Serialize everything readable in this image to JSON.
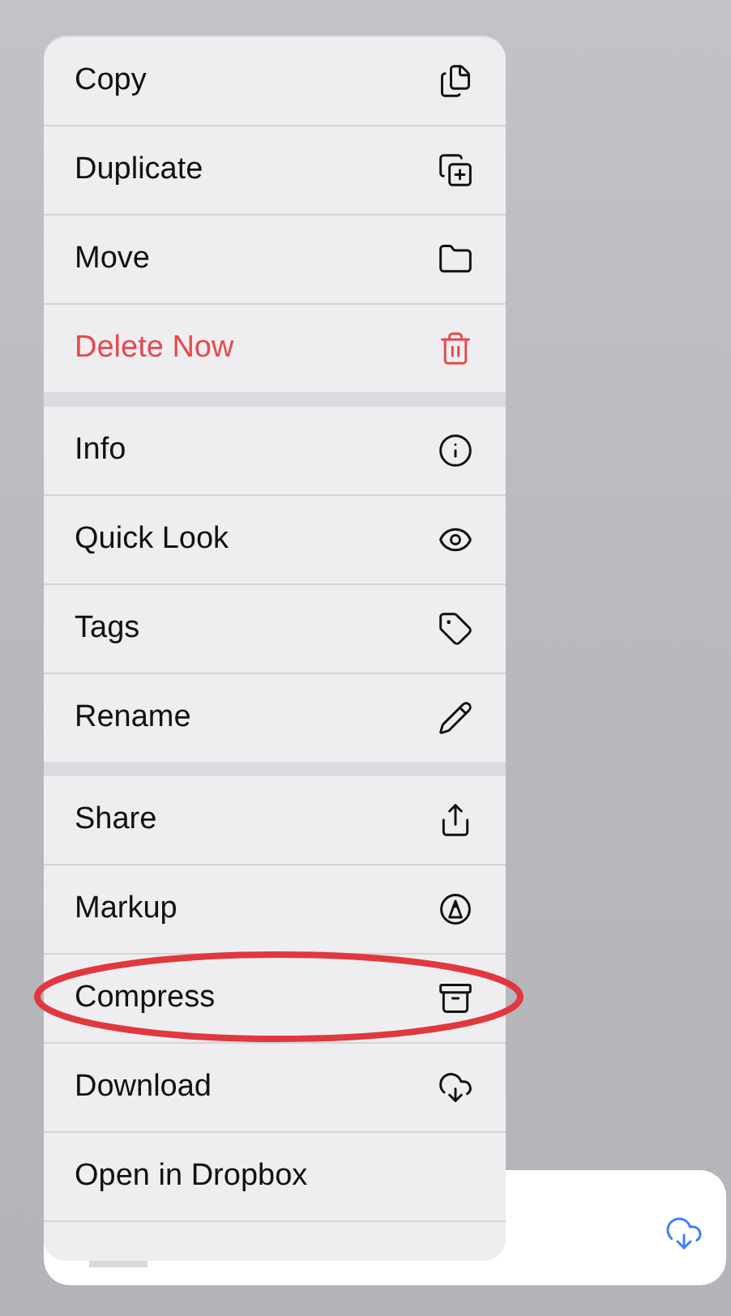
{
  "menu": {
    "groups": [
      {
        "items": [
          {
            "label": "Copy",
            "destructive": false,
            "circled": false
          },
          {
            "label": "Duplicate",
            "destructive": false,
            "circled": false
          },
          {
            "label": "Move",
            "destructive": false,
            "circled": false
          },
          {
            "label": "Delete Now",
            "destructive": true,
            "circled": false
          }
        ]
      },
      {
        "items": [
          {
            "label": "Info",
            "destructive": false,
            "circled": false
          },
          {
            "label": "Quick Look",
            "destructive": false,
            "circled": false
          },
          {
            "label": "Tags",
            "destructive": false,
            "circled": false
          },
          {
            "label": "Rename",
            "destructive": false,
            "circled": false
          }
        ]
      },
      {
        "items": [
          {
            "label": "Share",
            "destructive": false,
            "circled": false
          },
          {
            "label": "Markup",
            "destructive": false,
            "circled": false
          },
          {
            "label": "Compress",
            "destructive": false,
            "circled": true
          },
          {
            "label": "Download",
            "destructive": false,
            "circled": false
          },
          {
            "label": "Open in Dropbox",
            "destructive": false,
            "circled": false
          }
        ]
      }
    ]
  }
}
